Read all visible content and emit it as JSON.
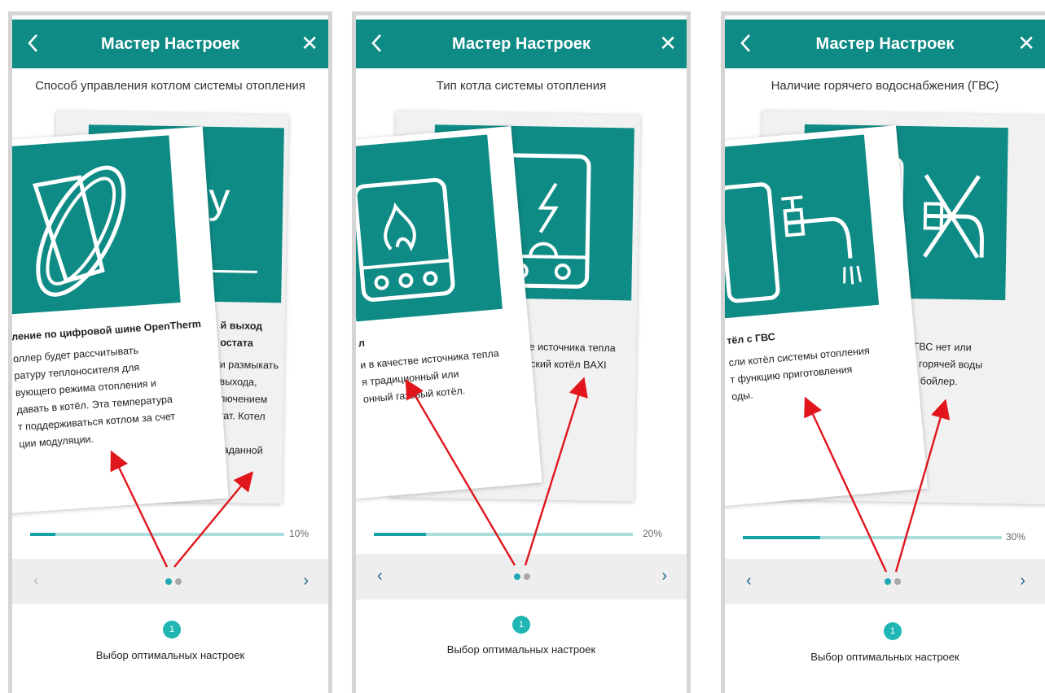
{
  "panels": [
    {
      "header_title": "Мастер Настроек",
      "subtitle": "Способ управления котлом системы отопления",
      "back_card_visible_text": [
        "ay",
        "й выход",
        "остата",
        "и размыкать",
        "выхода,",
        "лючением",
        "тат. Котел",
        "заданной"
      ],
      "front_card_title": "ление по цифровой шине OpenTherm",
      "front_card_text": [
        "оллер будет рассчитывать",
        "ратуру теплоносителя для",
        "вующего режима отопления и",
        "давать в котёл. Эта температура",
        "т поддерживаться котлом за счет",
        "ции модуляции."
      ],
      "progress_label": "10%",
      "progress_value": 0.1,
      "step_number": "1",
      "step_label": "Выбор оптимальных настроек"
    },
    {
      "header_title": "Мастер Настроек",
      "subtitle": "Тип котла системы отопления",
      "back_card_visible_text": [
        "л",
        "стве источника тепла",
        "ический котёл BAXI"
      ],
      "front_card_title": "л",
      "front_card_text": [
        "и в качестве источника тепла",
        "я традиционный или",
        "онный газовый котёл."
      ],
      "progress_label": "20%",
      "progress_value": 0.2,
      "step_number": "1",
      "step_label": "Выбор оптимальных настроек"
    },
    {
      "header_title": "Мастер Настроек",
      "subtitle": "Наличие горячего водоснабжения (ГВС)",
      "back_card_visible_text": [
        "С",
        "а ГВС нет или",
        "ия горячей воды",
        "ый бойлер."
      ],
      "front_card_title": "тёл с ГВС",
      "front_card_text": [
        "сли котёл системы отопления",
        "т функцию приготовления",
        "оды."
      ],
      "progress_label": "30%",
      "progress_value": 0.3,
      "step_number": "1",
      "step_label": "Выбор оптимальных настроек"
    }
  ],
  "nav": {
    "prev": "‹",
    "next": "›",
    "close": "✕"
  },
  "colors": {
    "teal": "#0f8b85",
    "progress_bg": "#a8dfdd",
    "progress_fill": "#16a3a3",
    "dot_active": "#1fa9b4",
    "dot_inactive": "#a8a8a8",
    "arrow": "#e0161c"
  },
  "icons": [
    "chevron-left-icon",
    "close-icon",
    "opentherm-board-icon",
    "relay-icon",
    "gas-boiler-icon",
    "electric-boiler-icon",
    "tap-icon",
    "no-tap-icon"
  ]
}
